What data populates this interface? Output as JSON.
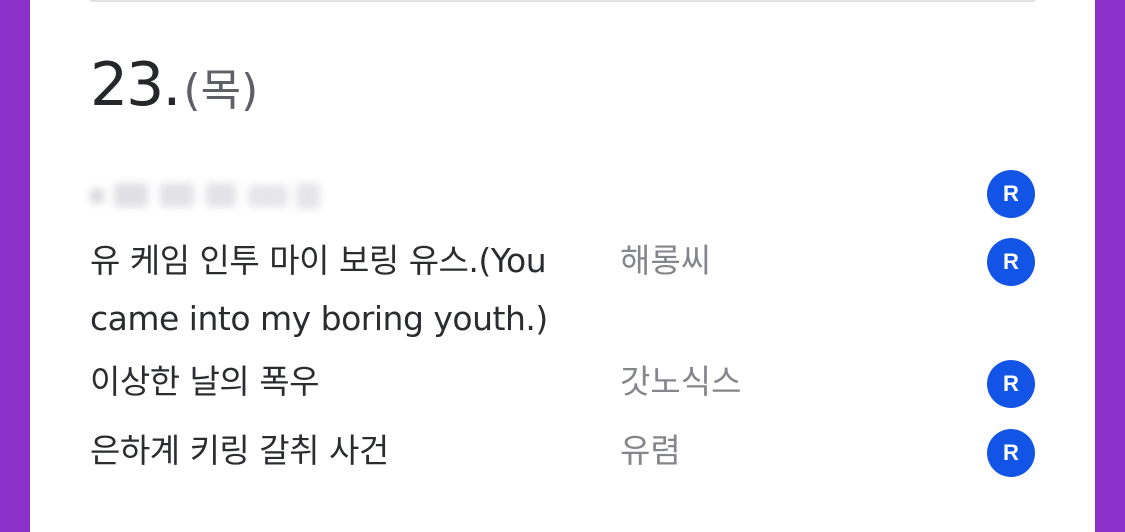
{
  "header": {
    "day_number": "23.",
    "day_of_week": "(목)"
  },
  "entries": [
    {
      "title": "",
      "author": "",
      "badge": "R",
      "faded": true
    },
    {
      "title": "유 케임 인투 마이 보링 유스.(You came into my boring youth.)",
      "author": "해롱씨",
      "badge": "R"
    },
    {
      "title": "이상한 날의 폭우",
      "author": "갓노식스",
      "badge": "R"
    },
    {
      "title": "은하계 키링 갈취 사건",
      "author": "유렴",
      "badge": "R"
    }
  ],
  "colors": {
    "background": "#8b31c9",
    "badge": "#1255e6",
    "title_text": "#2b2c30",
    "author_text": "#85868c"
  }
}
